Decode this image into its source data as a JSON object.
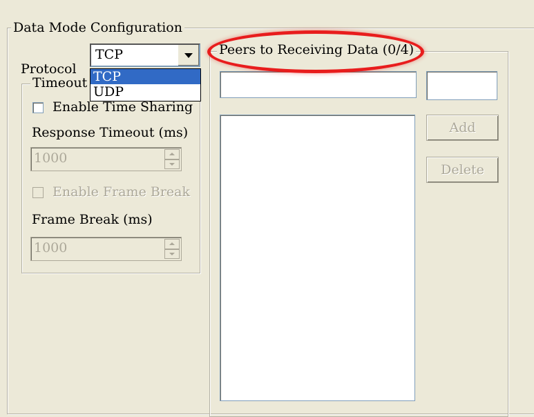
{
  "data_mode": {
    "title": "Data Mode Configuration",
    "protocol_label": "Protocol",
    "protocol_value": "TCP",
    "protocol_options": [
      "TCP",
      "UDP"
    ],
    "selected_option_index": 0
  },
  "timeout_group": {
    "title_visible": "Timeout S",
    "enable_time_sharing": "Enable Time Sharing",
    "response_timeout_label": "Response Timeout (ms)",
    "response_timeout_value": "1000",
    "enable_frame_break": "Enable Frame Break",
    "frame_break_label": "Frame Break (ms)",
    "frame_break_value": "1000"
  },
  "peers": {
    "title": "Peers to Receiving Data (0/4)",
    "ip_value": "",
    "port_value": "",
    "items": [],
    "add_label": "Add",
    "delete_label": "Delete"
  },
  "colors": {
    "window_bg": "#ece9d8",
    "selection": "#316ac5",
    "highlight_ring": "#e81d1d",
    "disabled_text": "#aca899"
  }
}
